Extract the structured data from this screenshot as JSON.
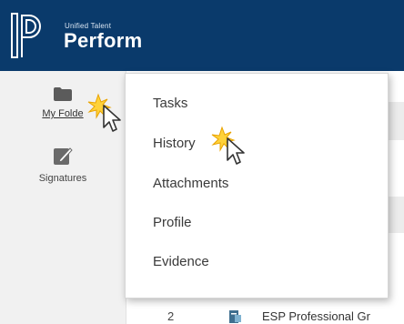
{
  "header": {
    "brand_sub": "Unified Talent",
    "brand_main": "Perform",
    "colors": {
      "background": "#0a3a6b",
      "text": "#ffffff"
    }
  },
  "sidebar": {
    "items": [
      {
        "label": "My Folde",
        "icon": "folder-icon"
      },
      {
        "label": "Signatures",
        "icon": "signature-icon"
      }
    ]
  },
  "dropdown": {
    "items": [
      {
        "label": "Tasks"
      },
      {
        "label": "History"
      },
      {
        "label": "Attachments"
      },
      {
        "label": "Profile"
      },
      {
        "label": "Evidence"
      }
    ]
  },
  "table": {
    "row": {
      "number": "2",
      "icon": "document-icon",
      "title": "ESP Professional Gr"
    }
  },
  "cursors": [
    {
      "icon": "click-cursor-icon",
      "near": "My Folde"
    },
    {
      "icon": "click-cursor-icon",
      "near": "History"
    }
  ]
}
